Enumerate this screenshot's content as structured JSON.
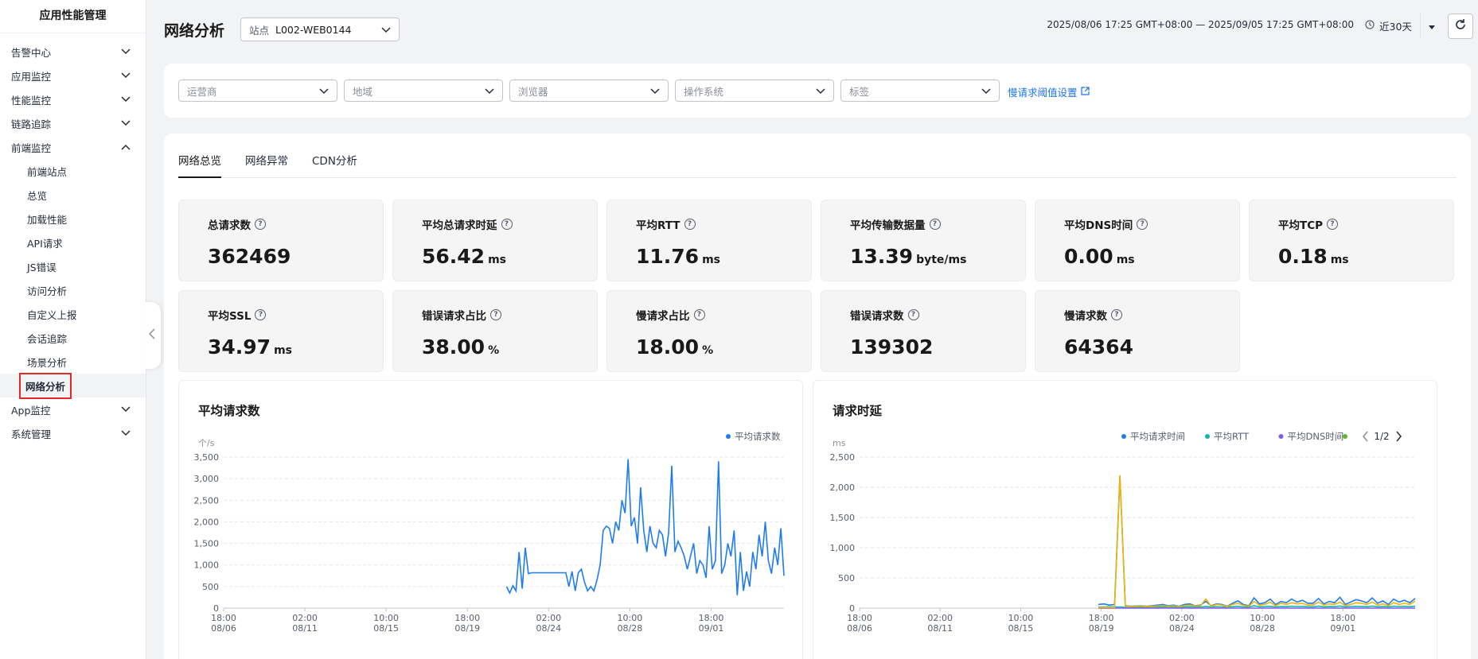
{
  "sidebar": {
    "title": "应用性能管理",
    "groups": [
      {
        "label": "告警中心",
        "expanded": false
      },
      {
        "label": "应用监控",
        "expanded": false
      },
      {
        "label": "性能监控",
        "expanded": false
      },
      {
        "label": "链路追踪",
        "expanded": false
      },
      {
        "label": "前端监控",
        "expanded": true
      }
    ],
    "sub_items": [
      "前端站点",
      "总览",
      "加载性能",
      "API请求",
      "JS错误",
      "访问分析",
      "自定义上报",
      "会话追踪",
      "场景分析",
      "网络分析"
    ],
    "active_sub": "网络分析",
    "bottom_groups": [
      {
        "label": "App监控"
      },
      {
        "label": "系统管理"
      }
    ]
  },
  "header": {
    "title": "网络分析",
    "site_label": "站点",
    "site_value": "L002-WEB0144",
    "time_range": "2025/08/06 17:25 GMT+08:00 — 2025/09/05 17:25 GMT+08:00",
    "range_label": "近30天"
  },
  "filters": {
    "items": [
      "运营商",
      "地域",
      "浏览器",
      "操作系统",
      "标签"
    ],
    "slow_link": "慢请求阈值设置"
  },
  "tabs": [
    "网络总览",
    "网络异常",
    "CDN分析"
  ],
  "active_tab": "网络总览",
  "metrics": [
    {
      "label": "总请求数",
      "value": "362469",
      "unit": ""
    },
    {
      "label": "平均总请求时延",
      "value": "56.42",
      "unit": "ms"
    },
    {
      "label": "平均RTT",
      "value": "11.76",
      "unit": "ms"
    },
    {
      "label": "平均传输数据量",
      "value": "13.39",
      "unit": "byte/ms"
    },
    {
      "label": "平均DNS时间",
      "value": "0.00",
      "unit": "ms"
    },
    {
      "label": "平均TCP",
      "value": "0.18",
      "unit": "ms"
    },
    {
      "label": "平均SSL",
      "value": "34.97",
      "unit": "ms"
    },
    {
      "label": "错误请求占比",
      "value": "38.00",
      "unit": "%"
    },
    {
      "label": "慢请求占比",
      "value": "18.00",
      "unit": "%"
    },
    {
      "label": "错误请求数",
      "value": "139302",
      "unit": ""
    },
    {
      "label": "慢请求数",
      "value": "64364",
      "unit": ""
    }
  ],
  "colors": {
    "primary_blue": "#1a73e8",
    "series_blue": "#1f7bf2",
    "series_teal": "#14b8a6",
    "series_purple": "#7c5cf0",
    "series_green": "#5bb82a",
    "series_yellow": "#f0b400",
    "active_highlight": "#e02b2b"
  },
  "chart_data": [
    {
      "type": "line",
      "title": "平均请求数",
      "ylabel": "个/s",
      "ylim": [
        0,
        3500
      ],
      "yticks": [
        "3,500",
        "3,000",
        "2,500",
        "2,000",
        "1,500",
        "1,000",
        "500",
        "0"
      ],
      "xticks": [
        [
          "18:00",
          "08/06"
        ],
        [
          "02:00",
          "08/11"
        ],
        [
          "10:00",
          "08/15"
        ],
        [
          "18:00",
          "08/19"
        ],
        [
          "02:00",
          "08/24"
        ],
        [
          "10:00",
          "08/28"
        ],
        [
          "18:00",
          "09/01"
        ]
      ],
      "legend": [
        "平均请求数"
      ],
      "series": [
        {
          "name": "平均请求数",
          "values": [
            500,
            350,
            520,
            400,
            1300,
            450,
            1400,
            800,
            820,
            820,
            820,
            820,
            820,
            820,
            820,
            820,
            820,
            820,
            820,
            820,
            500,
            850,
            400,
            820,
            900,
            600,
            400,
            500,
            400,
            650,
            1000,
            1800,
            1900,
            1850,
            1500,
            2000,
            1800,
            2500,
            2200,
            3450,
            1900,
            2100,
            1500,
            2800,
            1800,
            1300,
            1900,
            1500,
            1400,
            1800,
            1700,
            1200,
            1750,
            3300,
            1300,
            1550,
            1400,
            1200,
            900,
            1200,
            1500,
            800,
            1100,
            1000,
            700,
            1900,
            900,
            1100,
            3400,
            800,
            1000,
            1500,
            1200,
            1800,
            300,
            1300,
            400,
            850,
            500,
            1300,
            900,
            1700,
            1200,
            2000,
            1100,
            800,
            1400,
            1000,
            1850,
            750
          ]
        }
      ]
    },
    {
      "type": "line",
      "title": "请求时延",
      "ylabel": "ms",
      "ylim": [
        0,
        2500
      ],
      "yticks": [
        "2,500",
        "2,000",
        "1,500",
        "1,000",
        "500",
        "0"
      ],
      "xticks": [
        [
          "18:00",
          "08/06"
        ],
        [
          "02:00",
          "08/11"
        ],
        [
          "10:00",
          "08/15"
        ],
        [
          "18:00",
          "08/19"
        ],
        [
          "02:00",
          "08/24"
        ],
        [
          "10:00",
          "08/28"
        ],
        [
          "18:00",
          "09/01"
        ]
      ],
      "legend": [
        "平均请求时间",
        "平均RTT",
        "平均DNS时间"
      ],
      "pager": "1/2",
      "series": [
        {
          "name": "平均请求时间",
          "values": [
            60,
            70,
            50,
            60,
            2180,
            40,
            30,
            35,
            40,
            30,
            40,
            50,
            60,
            40,
            50,
            30,
            60,
            70,
            40,
            50,
            110,
            40,
            70,
            60,
            30,
            80,
            120,
            60,
            40,
            170,
            70,
            90,
            150,
            60,
            110,
            90,
            150,
            100,
            130,
            80,
            80,
            160,
            70,
            110,
            90,
            180,
            60,
            100,
            140,
            120,
            90,
            170,
            80,
            120,
            60,
            150,
            100,
            130,
            90,
            160
          ]
        },
        {
          "name": "平均RTT",
          "values": [
            20,
            18,
            22,
            20,
            20,
            15,
            18,
            16,
            20,
            14,
            20,
            22,
            20,
            18,
            22,
            14,
            20,
            22,
            18,
            20,
            28,
            20,
            24,
            20,
            18,
            24,
            30,
            20,
            18,
            40,
            22,
            26,
            30,
            20,
            28,
            24,
            32,
            26,
            28,
            22,
            22,
            34,
            22,
            28,
            24,
            36,
            20,
            26,
            30,
            28,
            24,
            34,
            22,
            28,
            20,
            32,
            26,
            30,
            24,
            32
          ]
        },
        {
          "name": "平均DNS时间",
          "values": [
            0,
            0,
            0,
            0,
            0,
            0,
            0,
            0,
            0,
            0,
            0,
            0,
            0,
            0,
            0,
            0,
            0,
            0,
            0,
            0,
            0,
            0,
            0,
            0,
            0,
            0,
            0,
            0,
            0,
            0,
            0,
            0,
            0,
            0,
            0,
            0,
            0,
            0,
            0,
            0,
            0,
            0,
            0,
            0,
            0,
            0,
            0,
            0,
            0,
            0,
            0,
            0,
            0,
            0,
            0,
            0,
            0,
            0,
            0,
            0
          ]
        },
        {
          "name": "",
          "values": [
            10,
            12,
            10,
            10,
            2200,
            30,
            25,
            30,
            35,
            25,
            30,
            35,
            40,
            30,
            40,
            25,
            40,
            50,
            35,
            40,
            150,
            30,
            60,
            50,
            25,
            60,
            80,
            45,
            30,
            110,
            50,
            60,
            100,
            40,
            80,
            60,
            90,
            70,
            80,
            50,
            50,
            100,
            50,
            70,
            60,
            100,
            40,
            60,
            90,
            80,
            60,
            100,
            50,
            70,
            40,
            90,
            60,
            80,
            60,
            120
          ]
        }
      ]
    }
  ]
}
